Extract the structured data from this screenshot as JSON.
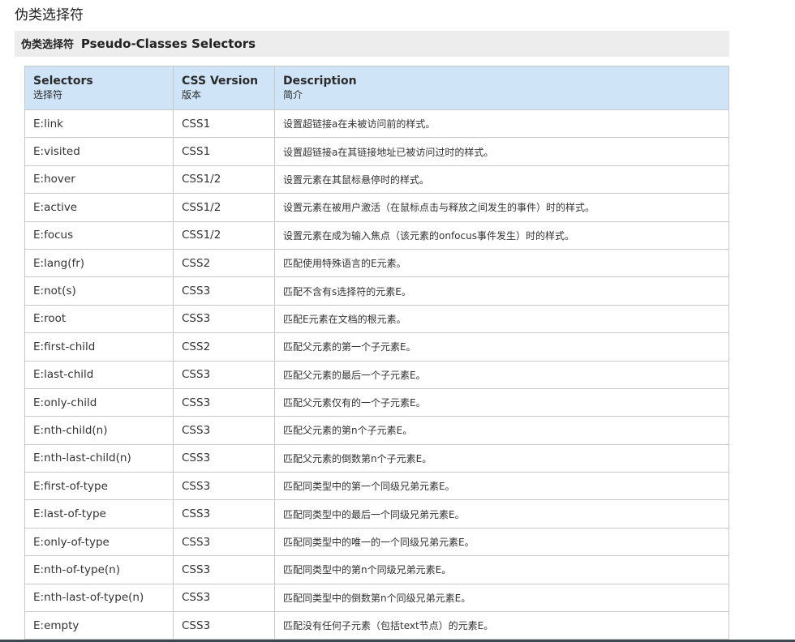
{
  "page": {
    "heading": "伪类选择符"
  },
  "figure": {
    "caption_cn": "伪类选择符",
    "caption_en": "Pseudo-Classes Selectors",
    "columns": [
      {
        "en": "Selectors",
        "cn": "选择符"
      },
      {
        "en": "CSS Version",
        "cn": "版本"
      },
      {
        "en": "Description",
        "cn": "简介"
      }
    ],
    "colors": {
      "green": "#2d8a1e",
      "orange": "#e8611a",
      "header_bg": "#cfe4f7",
      "caption_bg": "#ededed"
    },
    "rows": [
      {
        "selector": "E:link",
        "version": "CSS1",
        "description": "设置超链接a在未被访问前的样式。",
        "color": "green"
      },
      {
        "selector": "E:visited",
        "version": "CSS1",
        "description": "设置超链接a在其链接地址已被访问过时的样式。",
        "color": "green"
      },
      {
        "selector": "E:hover",
        "version": "CSS1/2",
        "description": "设置元素在其鼠标悬停时的样式。",
        "color": "green"
      },
      {
        "selector": "E:active",
        "version": "CSS1/2",
        "description": "设置元素在被用户激活（在鼠标点击与释放之间发生的事件）时的样式。",
        "color": "green"
      },
      {
        "selector": "E:focus",
        "version": "CSS1/2",
        "description": "设置元素在成为输入焦点（该元素的onfocus事件发生）时的样式。",
        "color": "green"
      },
      {
        "selector": "E:lang(fr)",
        "version": "CSS2",
        "description": "匹配使用特殊语言的E元素。",
        "color": "green"
      },
      {
        "selector": "E:not(s)",
        "version": "CSS3",
        "description": "匹配不含有s选择符的元素E。",
        "color": "orange"
      },
      {
        "selector": "E:root",
        "version": "CSS3",
        "description": "匹配E元素在文档的根元素。",
        "color": "orange"
      },
      {
        "selector": "E:first-child",
        "version": "CSS2",
        "description": "匹配父元素的第一个子元素E。",
        "color": "green"
      },
      {
        "selector": "E:last-child",
        "version": "CSS3",
        "description": "匹配父元素的最后一个子元素E。",
        "color": "orange"
      },
      {
        "selector": "E:only-child",
        "version": "CSS3",
        "description": "匹配父元素仅有的一个子元素E。",
        "color": "orange"
      },
      {
        "selector": "E:nth-child(n)",
        "version": "CSS3",
        "description": "匹配父元素的第n个子元素E。",
        "color": "orange"
      },
      {
        "selector": "E:nth-last-child(n)",
        "version": "CSS3",
        "description": "匹配父元素的倒数第n个子元素E。",
        "color": "orange"
      },
      {
        "selector": "E:first-of-type",
        "version": "CSS3",
        "description": "匹配同类型中的第一个同级兄弟元素E。",
        "color": "orange"
      },
      {
        "selector": "E:last-of-type",
        "version": "CSS3",
        "description": "匹配同类型中的最后一个同级兄弟元素E。",
        "color": "orange"
      },
      {
        "selector": "E:only-of-type",
        "version": "CSS3",
        "description": "匹配同类型中的唯一的一个同级兄弟元素E。",
        "color": "orange"
      },
      {
        "selector": "E:nth-of-type(n)",
        "version": "CSS3",
        "description": "匹配同类型中的第n个同级兄弟元素E。",
        "color": "orange"
      },
      {
        "selector": "E:nth-last-of-type(n)",
        "version": "CSS3",
        "description": "匹配同类型中的倒数第n个同级兄弟元素E。",
        "color": "orange"
      },
      {
        "selector": "E:empty",
        "version": "CSS3",
        "description": "匹配没有任何子元素（包括text节点）的元素E。",
        "color": "orange"
      }
    ]
  }
}
